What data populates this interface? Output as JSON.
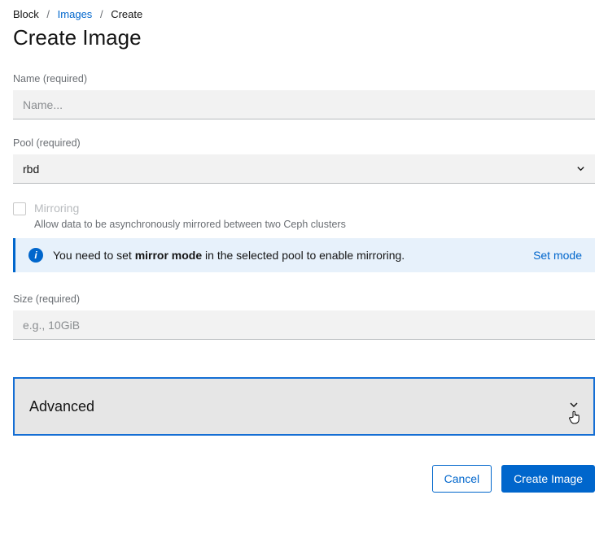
{
  "breadcrumb": {
    "item0": "Block",
    "item1": "Images",
    "item2": "Create"
  },
  "page_title": "Create Image",
  "fields": {
    "name": {
      "label": "Name (required)",
      "placeholder": "Name...",
      "value": ""
    },
    "pool": {
      "label": "Pool (required)",
      "value": "rbd"
    },
    "mirroring": {
      "label": "Mirroring",
      "description": "Allow data to be asynchronously mirrored between two Ceph clusters",
      "checked": false
    },
    "size": {
      "label": "Size (required)",
      "placeholder": "e.g., 10GiB",
      "value": ""
    }
  },
  "info_banner": {
    "pre": "You need to set ",
    "bold": "mirror mode",
    "post": " in the selected pool to enable mirroring.",
    "link": "Set mode"
  },
  "advanced": {
    "title": "Advanced"
  },
  "buttons": {
    "cancel": "Cancel",
    "submit": "Create Image"
  }
}
